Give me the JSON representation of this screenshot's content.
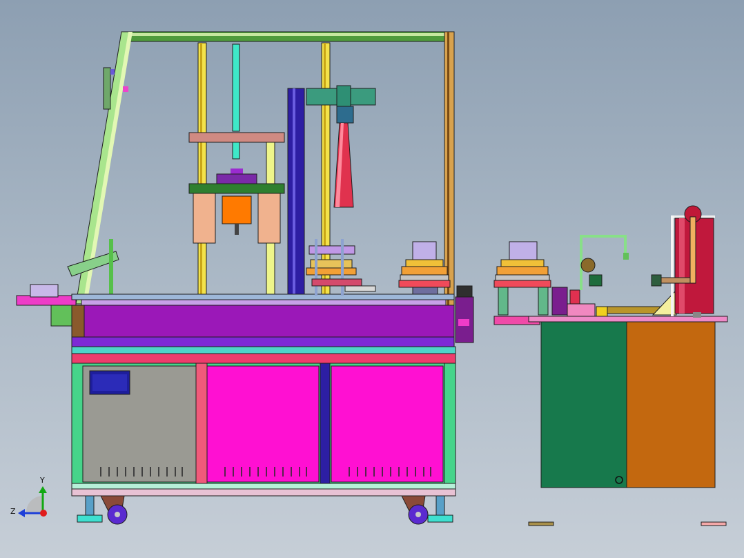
{
  "axis_triad": {
    "y_label": "Y",
    "z_label": "Z",
    "colors": {
      "y": "#11a811",
      "z": "#1d3fd8",
      "x": "#e01c1c"
    }
  },
  "palette": {
    "magenta_panel": "#ff10d2",
    "purple_bed": "#9b18b8",
    "grey_panel": "#9a9a93",
    "green_cabinet": "#17794c",
    "orange_cabinet": "#c3680f",
    "yellow_post": "#f3e24a",
    "navy_column": "#2d1ea3",
    "teal_rod": "#3ee8c8",
    "pink_cone": "#e0324e",
    "red_cylinder": "#c0183c"
  }
}
